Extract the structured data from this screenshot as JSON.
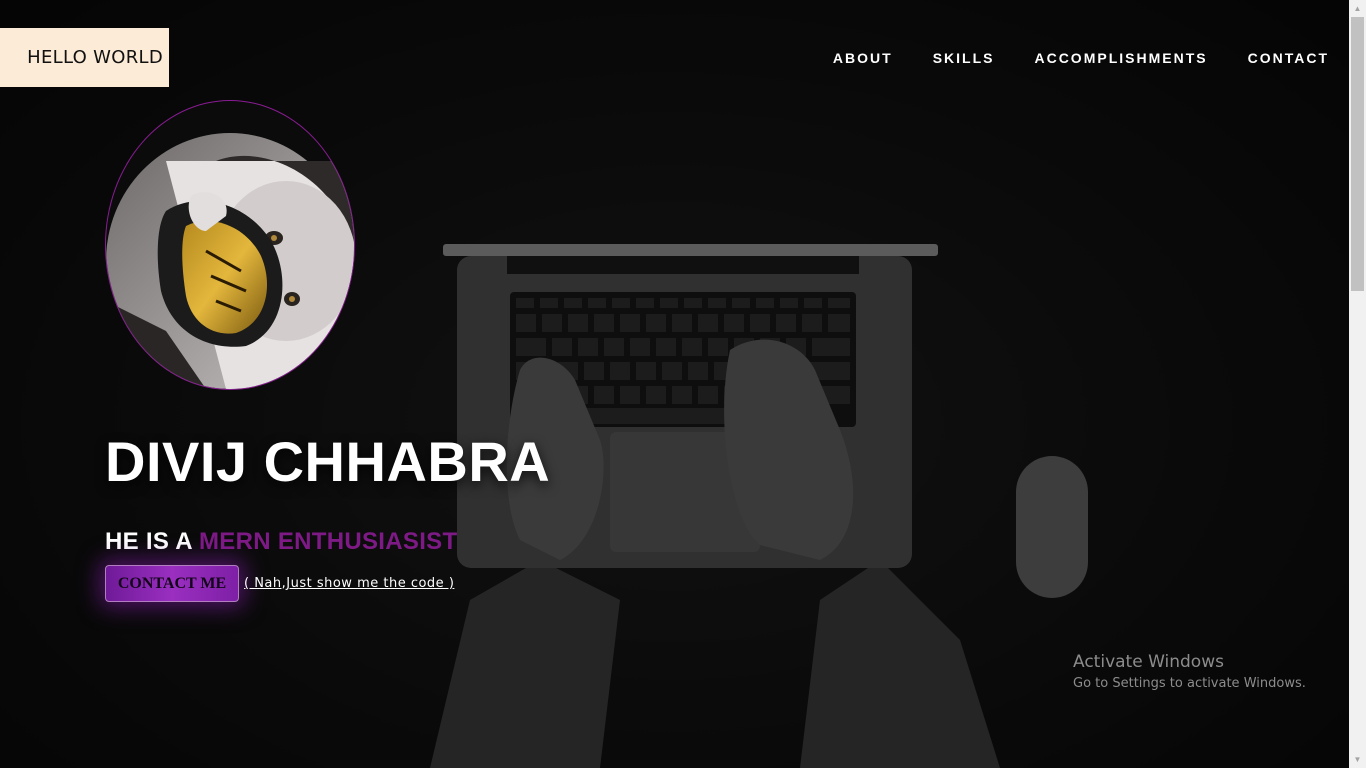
{
  "logo": {
    "text": "HELLO WORLD"
  },
  "nav": {
    "items": [
      {
        "label": "ABOUT"
      },
      {
        "label": "SKILLS"
      },
      {
        "label": "ACCOMPLISHMENTS"
      },
      {
        "label": "CONTACT"
      }
    ]
  },
  "hero": {
    "name": "DIVIJ CHHABRA",
    "tagline_prefix": "HE IS A ",
    "tagline_role": "MERN ENTHUSIASIST",
    "contact_button": "CONTACT ME",
    "code_link": "( Nah,Just show me the code )"
  },
  "watermark": {
    "title": "Activate Windows",
    "subtitle": "Go to Settings to activate Windows."
  },
  "colors": {
    "logo_bg": "#fcebd6",
    "accent": "#7e1a86",
    "button_gradient": "#8a25b5",
    "background": "#0b0b0b"
  },
  "icons": {
    "avatar": "profile-photo",
    "hero_background": "laptop-desk-photo"
  }
}
